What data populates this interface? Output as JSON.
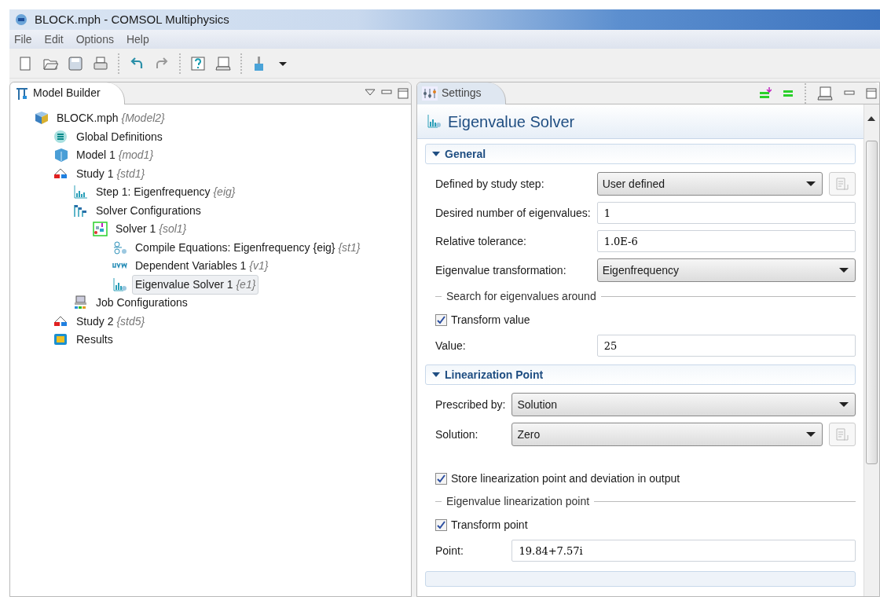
{
  "window": {
    "title": "BLOCK.mph - COMSOL Multiphysics"
  },
  "menu": [
    "File",
    "Edit",
    "Options",
    "Help"
  ],
  "toolbar": [
    {
      "kind": "new"
    },
    {
      "kind": "open"
    },
    {
      "kind": "save"
    },
    {
      "kind": "print"
    },
    {
      "kind": "sep"
    },
    {
      "kind": "undo"
    },
    {
      "kind": "redo"
    },
    {
      "kind": "sep"
    },
    {
      "kind": "help"
    },
    {
      "kind": "helpdesk"
    },
    {
      "kind": "sep"
    },
    {
      "kind": "brush"
    },
    {
      "kind": "caret"
    }
  ],
  "model_builder": {
    "title": "Model Builder",
    "tree": [
      {
        "kind": "file",
        "label": "BLOCK.mph",
        "tag": "{Model2}",
        "selected": false,
        "children": [
          {
            "kind": "global",
            "label": "Global Definitions",
            "selected": false
          },
          {
            "kind": "cube",
            "label": "Model 1",
            "tag": "{mod1}",
            "selected": false
          },
          {
            "kind": "study",
            "label": "Study 1",
            "tag": "{std1}",
            "selected": false,
            "children": [
              {
                "kind": "bars",
                "label": "Step 1: Eigenfrequency",
                "tag": "{eig}",
                "selected": false
              },
              {
                "kind": "flags",
                "label": "Solver Configurations",
                "selected": false,
                "children": [
                  {
                    "kind": "solver",
                    "label": "Solver 1",
                    "tag": "{sol1}",
                    "selected": false,
                    "children": [
                      {
                        "kind": "deriv",
                        "label": "Compile Equations: Eigenfrequency {eig}",
                        "tag": "{st1}",
                        "selected": false
                      },
                      {
                        "kind": "uvw",
                        "label": "Dependent Variables 1",
                        "tag": "{v1}",
                        "selected": false
                      },
                      {
                        "kind": "eigen",
                        "label": "Eigenvalue Solver 1",
                        "tag": "{e1}",
                        "selected": true
                      }
                    ]
                  }
                ]
              },
              {
                "kind": "job",
                "label": "Job Configurations",
                "selected": false
              }
            ]
          },
          {
            "kind": "study",
            "label": "Study 2",
            "tag": "{std5}",
            "selected": false
          },
          {
            "kind": "results",
            "label": "Results",
            "selected": false
          }
        ]
      }
    ]
  },
  "settings": {
    "tab": "Settings",
    "heading": "Eigenvalue Solver",
    "sections": [
      {
        "title": "General",
        "expanded": true,
        "rows": [
          {
            "kind": "select",
            "label": "Defined by study step:",
            "value": "User defined",
            "side_button": true
          },
          {
            "kind": "text",
            "label": "Desired number of eigenvalues:",
            "value": "1"
          },
          {
            "kind": "text",
            "label": "Relative tolerance:",
            "value": "1.0E-6"
          },
          {
            "kind": "select",
            "label": "Eigenvalue transformation:",
            "value": "Eigenfrequency",
            "side_button": false
          },
          {
            "kind": "group",
            "label": "Search for eigenvalues around"
          },
          {
            "kind": "checkbox",
            "label": "Transform value",
            "checked": true
          },
          {
            "kind": "text",
            "label": "Value:",
            "value": "25"
          }
        ]
      },
      {
        "title": "Linearization Point",
        "expanded": true,
        "rows": [
          {
            "kind": "select",
            "label": "Prescribed by:",
            "value": "Solution",
            "side_button": false
          },
          {
            "kind": "select",
            "label": "Solution:",
            "value": "Zero",
            "side_button": true
          },
          {
            "kind": "spacer"
          },
          {
            "kind": "checkbox",
            "label": "Store linearization point and deviation in output",
            "checked": true
          },
          {
            "kind": "group",
            "label": "Eigenvalue linearization point"
          },
          {
            "kind": "checkbox",
            "label": "Transform point",
            "checked": true
          },
          {
            "kind": "text",
            "label": "Point:",
            "value": "19.84+7.57i"
          }
        ]
      }
    ]
  }
}
